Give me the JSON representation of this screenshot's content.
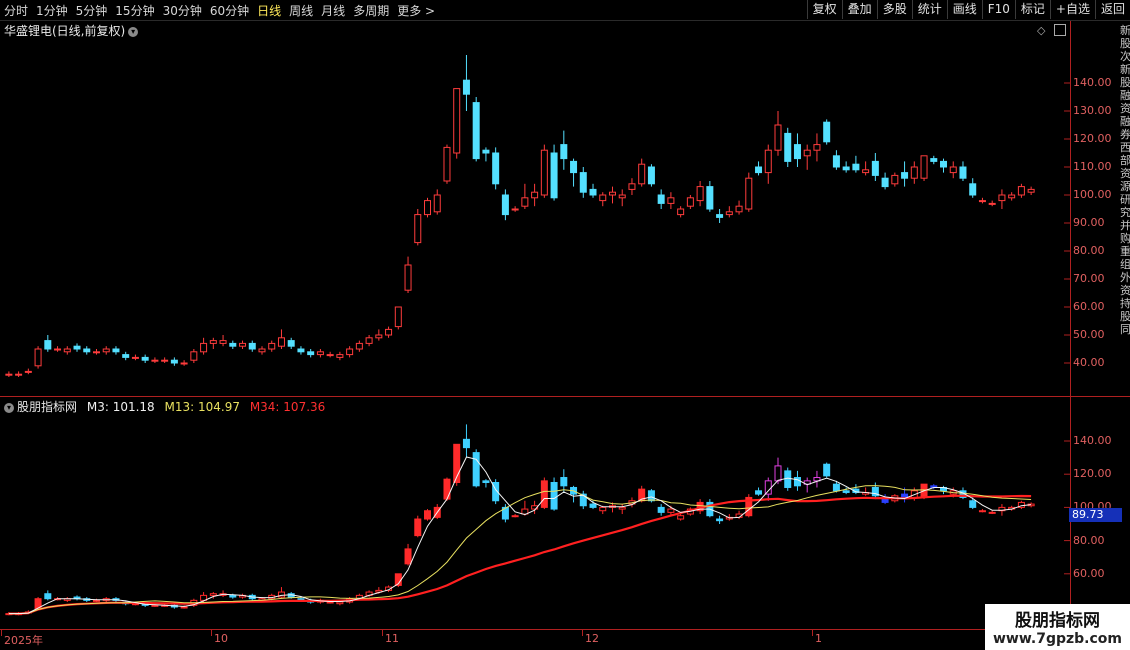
{
  "toolbar": {
    "periods": [
      "分时",
      "1分钟",
      "5分钟",
      "15分钟",
      "30分钟",
      "60分钟",
      "日线",
      "周线",
      "月线",
      "多周期",
      "更多 >"
    ],
    "active_period": "日线",
    "tools": [
      "复权",
      "叠加",
      "多股",
      "统计",
      "画线",
      "F10",
      "标记",
      "+自选",
      "返回"
    ]
  },
  "main_panel": {
    "title": "华盛锂电(日线,前复权)",
    "y_ticks": [
      "140.00",
      "130.00",
      "120.00",
      "110.00",
      "100.00",
      "90.00",
      "80.00",
      "70.00",
      "60.00",
      "50.00",
      "40.00"
    ]
  },
  "indicator_panel": {
    "name": "股朋指标网",
    "m3_label": "M3: 101.18",
    "m13_label": "M13: 104.97",
    "m34_label": "M34: 107.36",
    "y_ticks": [
      "140.00",
      "120.00",
      "100.00",
      "80.00",
      "60.00"
    ],
    "current_value": "89.73"
  },
  "x_axis": {
    "labels": [
      "2025年",
      "10",
      "11",
      "12",
      "1"
    ]
  },
  "side_text": "新股次新股融资融券西部资源研究并购重组外资持股同",
  "watermark": {
    "title": "股朋指标网",
    "url": "www.7gpzb.com"
  },
  "colors": {
    "up": "#ff3c3c",
    "down": "#54e0ff",
    "m3": "#f5f5f5",
    "m13": "#e8e060",
    "m34": "#ff2020",
    "axis": "#b02020"
  },
  "chart_data": {
    "type": "candlestick",
    "ylim": [
      32,
      150
    ],
    "candles": [
      [
        36,
        37,
        35,
        36
      ],
      [
        36,
        37,
        35,
        36
      ],
      [
        37,
        38,
        36,
        37
      ],
      [
        39,
        46,
        38,
        45
      ],
      [
        48,
        50,
        44,
        45
      ],
      [
        45,
        46,
        44,
        45
      ],
      [
        44,
        46,
        43,
        45
      ],
      [
        46,
        47,
        44,
        45
      ],
      [
        45,
        46,
        43,
        44
      ],
      [
        44,
        45,
        43,
        44
      ],
      [
        44,
        46,
        43,
        45
      ],
      [
        45,
        46,
        43,
        44
      ],
      [
        43,
        44,
        41,
        42
      ],
      [
        42,
        43,
        41,
        42
      ],
      [
        42,
        43,
        40,
        41
      ],
      [
        41,
        42,
        40,
        41
      ],
      [
        41,
        42,
        40,
        41
      ],
      [
        41,
        42,
        39,
        40
      ],
      [
        40,
        41,
        39,
        40
      ],
      [
        41,
        45,
        40,
        44
      ],
      [
        44,
        49,
        43,
        47
      ],
      [
        47,
        49,
        45,
        48
      ],
      [
        47,
        50,
        46,
        48
      ],
      [
        47,
        48,
        45,
        46
      ],
      [
        46,
        48,
        45,
        47
      ],
      [
        47,
        48,
        44,
        45
      ],
      [
        44,
        46,
        43,
        45
      ],
      [
        45,
        48,
        44,
        47
      ],
      [
        46,
        52,
        45,
        49
      ],
      [
        48,
        49,
        45,
        46
      ],
      [
        45,
        46,
        43,
        44
      ],
      [
        44,
        45,
        42,
        43
      ],
      [
        43,
        45,
        42,
        44
      ],
      [
        43,
        44,
        42,
        43
      ],
      [
        42,
        44,
        41,
        43
      ],
      [
        43,
        46,
        42,
        45
      ],
      [
        45,
        48,
        44,
        47
      ],
      [
        47,
        50,
        46,
        49
      ],
      [
        49,
        52,
        48,
        50
      ],
      [
        50,
        53,
        49,
        52
      ],
      [
        53,
        60,
        52,
        60
      ],
      [
        66,
        78,
        65,
        75
      ],
      [
        83,
        95,
        82,
        93
      ],
      [
        93,
        99,
        92,
        98
      ],
      [
        94,
        102,
        93,
        100
      ],
      [
        105,
        118,
        104,
        117
      ],
      [
        115,
        138,
        113,
        138
      ],
      [
        141,
        150,
        130,
        136
      ],
      [
        133,
        135,
        112,
        113
      ],
      [
        116,
        117,
        112,
        115
      ],
      [
        115,
        117,
        102,
        104
      ],
      [
        100,
        102,
        91,
        93
      ],
      [
        95,
        96,
        94,
        95
      ],
      [
        96,
        104,
        95,
        99
      ],
      [
        99,
        104,
        96,
        101
      ],
      [
        100,
        118,
        99,
        116
      ],
      [
        115,
        118,
        98,
        99
      ],
      [
        118,
        123,
        109,
        113
      ],
      [
        112,
        113,
        103,
        108
      ],
      [
        108,
        110,
        99,
        101
      ],
      [
        102,
        104,
        99,
        100
      ],
      [
        98,
        101,
        96,
        100
      ],
      [
        100,
        103,
        97,
        101
      ],
      [
        99,
        102,
        96,
        100
      ],
      [
        102,
        106,
        100,
        104
      ],
      [
        104,
        113,
        103,
        111
      ],
      [
        110,
        111,
        103,
        104
      ],
      [
        100,
        102,
        95,
        97
      ],
      [
        97,
        101,
        95,
        99
      ],
      [
        93,
        96,
        92,
        95
      ],
      [
        96,
        100,
        95,
        99
      ],
      [
        98,
        105,
        96,
        103
      ],
      [
        103,
        105,
        94,
        95
      ],
      [
        93,
        95,
        90,
        92
      ],
      [
        93,
        96,
        92,
        94
      ],
      [
        94,
        98,
        93,
        96
      ],
      [
        95,
        108,
        94,
        106
      ],
      [
        110,
        112,
        107,
        108
      ],
      [
        108,
        118,
        104,
        116
      ],
      [
        116,
        130,
        114,
        125
      ],
      [
        122,
        124,
        110,
        112
      ],
      [
        118,
        122,
        110,
        113
      ],
      [
        114,
        118,
        109,
        116
      ],
      [
        116,
        122,
        112,
        118
      ],
      [
        126,
        127,
        118,
        119
      ],
      [
        114,
        116,
        109,
        110
      ],
      [
        110,
        112,
        108,
        109
      ],
      [
        111,
        114,
        108,
        109
      ],
      [
        108,
        112,
        107,
        109
      ],
      [
        112,
        115,
        105,
        107
      ],
      [
        106,
        108,
        102,
        103
      ],
      [
        104,
        108,
        103,
        107
      ],
      [
        108,
        112,
        103,
        106
      ],
      [
        106,
        112,
        104,
        110
      ],
      [
        106,
        114,
        105,
        114
      ],
      [
        113,
        114,
        111,
        112
      ],
      [
        112,
        113,
        108,
        110
      ],
      [
        108,
        112,
        106,
        110
      ],
      [
        110,
        112,
        105,
        106
      ],
      [
        104,
        106,
        99,
        100
      ],
      [
        98,
        99,
        97,
        98
      ],
      [
        97,
        98,
        96,
        97
      ],
      [
        98,
        102,
        95,
        100
      ],
      [
        99,
        101,
        98,
        100
      ],
      [
        100,
        104,
        99,
        103
      ],
      [
        101,
        103,
        100,
        102
      ]
    ]
  }
}
